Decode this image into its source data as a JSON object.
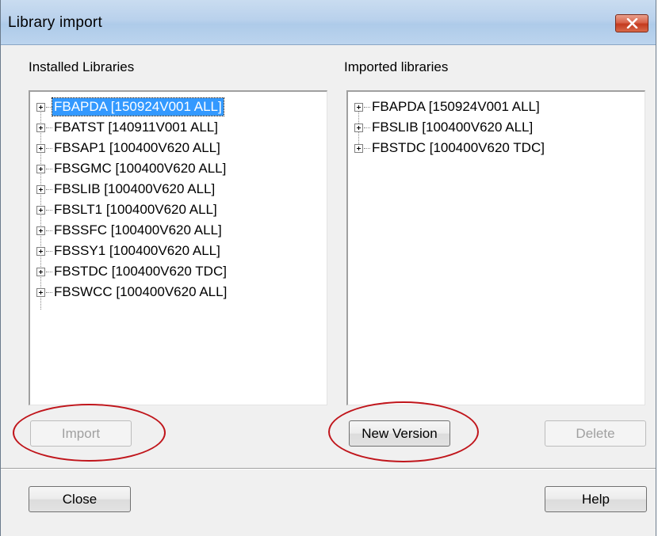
{
  "window": {
    "title": "Library import"
  },
  "installed": {
    "label": "Installed Libraries",
    "items": [
      "FBAPDA  [150924V001 ALL]",
      "FBATST  [140911V001 ALL]",
      "FBSAP1  [100400V620 ALL]",
      "FBSGMC  [100400V620 ALL]",
      "FBSLIB  [100400V620 ALL]",
      "FBSLT1  [100400V620 ALL]",
      "FBSSFC  [100400V620 ALL]",
      "FBSSY1  [100400V620 ALL]",
      "FBSTDC  [100400V620 TDC]",
      "FBSWCC  [100400V620 ALL]"
    ],
    "selected_index": 0
  },
  "imported": {
    "label": "Imported libraries",
    "items": [
      "FBAPDA  [150924V001 ALL]",
      "FBSLIB  [100400V620 ALL]",
      "FBSTDC  [100400V620 TDC]"
    ]
  },
  "buttons": {
    "import": "Import",
    "new_version": "New Version",
    "delete": "Delete",
    "close": "Close",
    "help": "Help"
  },
  "colors": {
    "selection": "#3399ff",
    "annotation_circle": "#c0151b",
    "titlebar": "#b9d1ec",
    "close_button": "#c43a1e"
  },
  "icons": {
    "window_close": "close-icon",
    "tree_expander": "plus-box-icon"
  }
}
